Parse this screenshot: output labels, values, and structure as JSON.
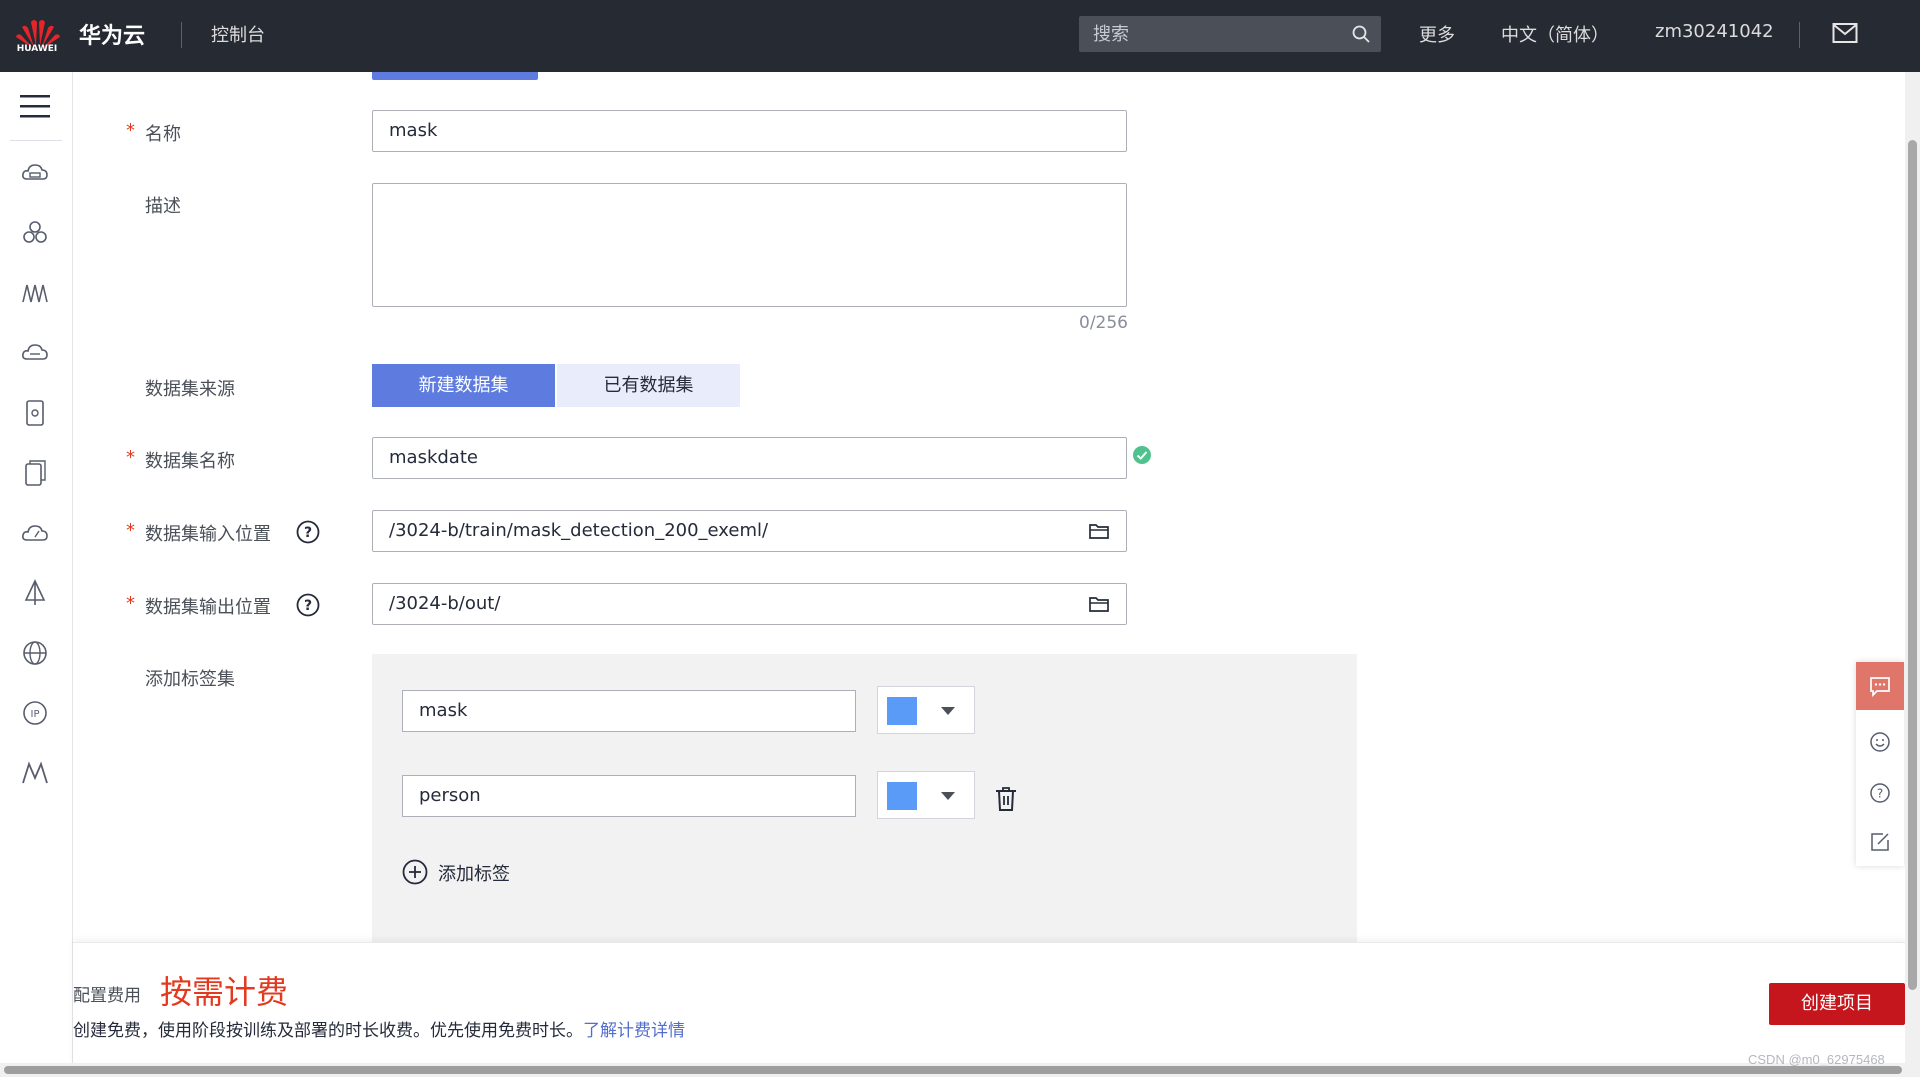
{
  "header": {
    "logo_text": "HUAWEI",
    "brand": "华为云",
    "console": "控制台",
    "search_placeholder": "搜索",
    "more": "更多",
    "language": "中文（简体）",
    "username": "zm30241042"
  },
  "sidebar": {
    "icons": [
      "cloud-server-icon",
      "cluster-icon",
      "modelarts-icon",
      "cloud-container-icon",
      "storage-icon",
      "backup-icon",
      "cloud-speed-icon",
      "network-icon",
      "global-web-icon",
      "ip-icon",
      "modelarts-alt-icon"
    ]
  },
  "form": {
    "name_label": "名称",
    "name_value": "mask",
    "desc_label": "描述",
    "desc_counter": "0/256",
    "source_label": "数据集来源",
    "source_new": "新建数据集",
    "source_existing": "已有数据集",
    "dataset_name_label": "数据集名称",
    "dataset_name_value": "maskdate",
    "input_path_label": "数据集输入位置",
    "input_path_value": "/3024-b/train/mask_detection_200_exeml/",
    "output_path_label": "数据集输出位置",
    "output_path_value": "/3024-b/out/",
    "label_set_label": "添加标签集",
    "labels": [
      {
        "name": "mask",
        "color": "#5b9bf8"
      },
      {
        "name": "person",
        "color": "#5b9bf8"
      }
    ],
    "add_label": "添加标签",
    "required_mark": "*"
  },
  "footer": {
    "fee_label": "配置费用",
    "fee_value": "按需计费",
    "fee_desc": "创建免费，使用阶段按训练及部署的时长收费。优先使用免费时长。",
    "fee_link": "了解计费详情",
    "create_button": "创建项目"
  },
  "watermark": "CSDN @m0_62975468",
  "colors": {
    "header_bg": "#252a33",
    "primary": "#5e7ce0",
    "danger": "#c4161c",
    "required": "#e2391f",
    "success": "#50c28e"
  }
}
